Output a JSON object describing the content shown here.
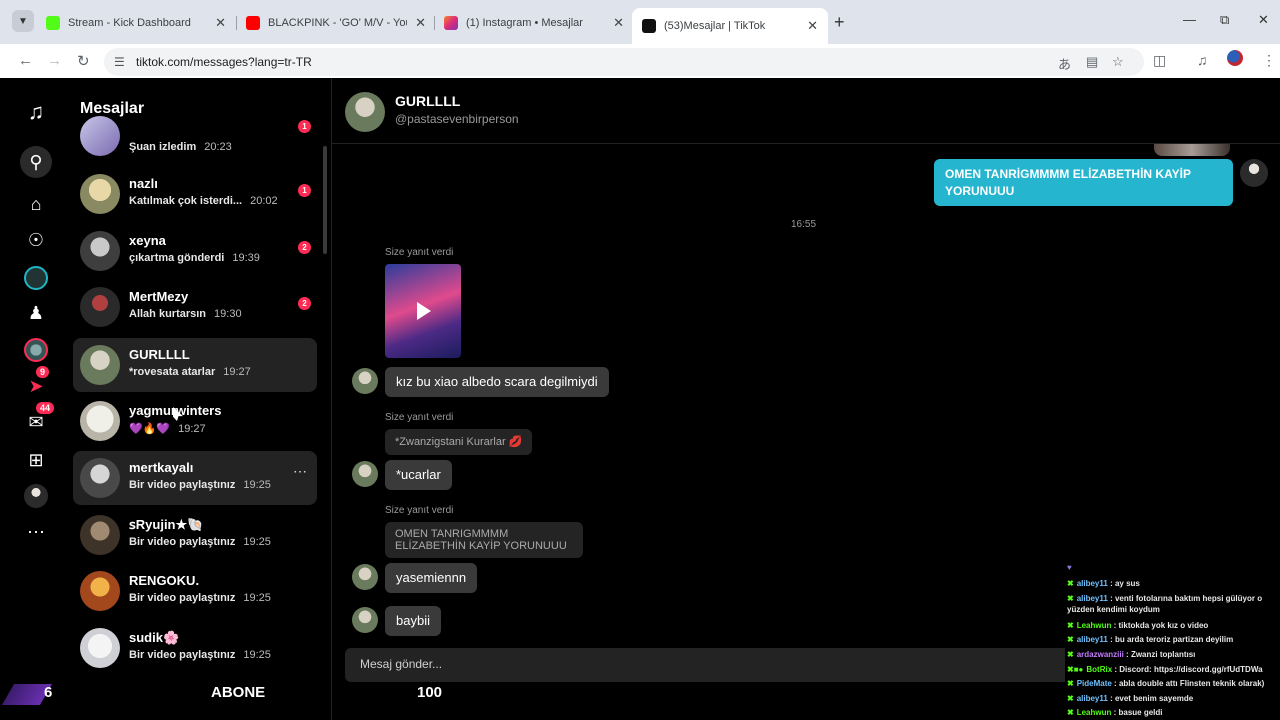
{
  "browser": {
    "tabs": [
      {
        "label": "Stream - Kick Dashboard",
        "color": "#53fc18"
      },
      {
        "label": "BLACKPINK - 'GO' M/V - YouTube",
        "color": "#ff0000"
      },
      {
        "label": "(1) Instagram • Mesajlar",
        "color": "#e1306c"
      },
      {
        "label": "(53)Mesajlar | TikTok",
        "color": "#111111"
      }
    ],
    "url": "tiktok.com/messages?lang=tr-TR"
  },
  "nav": {
    "messages_badge": "44",
    "inbox_badge": "9"
  },
  "inbox": {
    "title": "Mesajlar",
    "conversations": [
      {
        "name": "",
        "preview": "Şuan izledim",
        "time": "20:23",
        "badge": "1"
      },
      {
        "name": "nazlı",
        "preview": "Katılmak çok isterdi...",
        "time": "20:02",
        "badge": "1"
      },
      {
        "name": "xeyna",
        "preview": "çıkartma gönderdi",
        "time": "19:39",
        "badge": "2"
      },
      {
        "name": "MertMezy",
        "preview": "Allah kurtarsın",
        "time": "19:30",
        "badge": "2"
      },
      {
        "name": "GURLLLL",
        "preview": "*rovesata atarlar",
        "time": "19:27",
        "badge": ""
      },
      {
        "name": "yagmurwinters",
        "preview": "💜🔥💜",
        "time": "19:27",
        "badge": ""
      },
      {
        "name": "mertkayalı",
        "preview": "Bir video paylaştınız",
        "time": "19:25",
        "badge": ""
      },
      {
        "name": "ꜱRyujin★🐚",
        "preview": "Bir video paylaştınız",
        "time": "19:25",
        "badge": ""
      },
      {
        "name": "RENGOKU.",
        "preview": "Bir video paylaştınız",
        "time": "19:25",
        "badge": ""
      },
      {
        "name": "sudik🌸",
        "preview": "Bir video paylaştınız",
        "time": "19:25",
        "badge": ""
      }
    ]
  },
  "chat": {
    "name": "GURLLLL",
    "handle": "@pastasevenbirperson",
    "my_message": "OMEN TANRİGMMMM ELİZABETHİN KAYİP YORUNUUU",
    "timestamp": "16:55",
    "reply_label": "Size yanıt verdi",
    "messages": [
      "kız bu xiao albedo scara degilmiydi",
      "*ucarlar",
      "yasemiennn",
      "baybii"
    ],
    "quotes": [
      "*Zwanzigstani Kurarlar 💋",
      "OMEN TANRIGMMMM ELİZABETHİN KAYİP YORUNUUU"
    ],
    "input_placeholder": "Mesaj gönder..."
  },
  "overlay": {
    "count_left": "6",
    "abone": "ABONE",
    "count_right": "100",
    "chat": [
      {
        "user": "alibey11",
        "text": "ay sus"
      },
      {
        "user": "alibey11",
        "text": "venti fotolarına baktım hepsi gülüyor o yüzden kendimi koydum"
      },
      {
        "user": "Leahwun",
        "text": "tiktokda yok kız o video"
      },
      {
        "user": "alibey11",
        "text": "bu arda teroriz partizan deyilim"
      },
      {
        "user": "ardazwanziii",
        "text": "Zwanzi toplantısı"
      },
      {
        "user": "BotRix",
        "text": "Discord: https://discord.gg/rfUdTDWa"
      },
      {
        "user": "PideMate",
        "text": "abla double attı Flinsten teknik olarak)"
      },
      {
        "user": "alibey11",
        "text": "evet benim sayemde"
      },
      {
        "user": "Leahwun",
        "text": "basue geldi"
      }
    ]
  }
}
